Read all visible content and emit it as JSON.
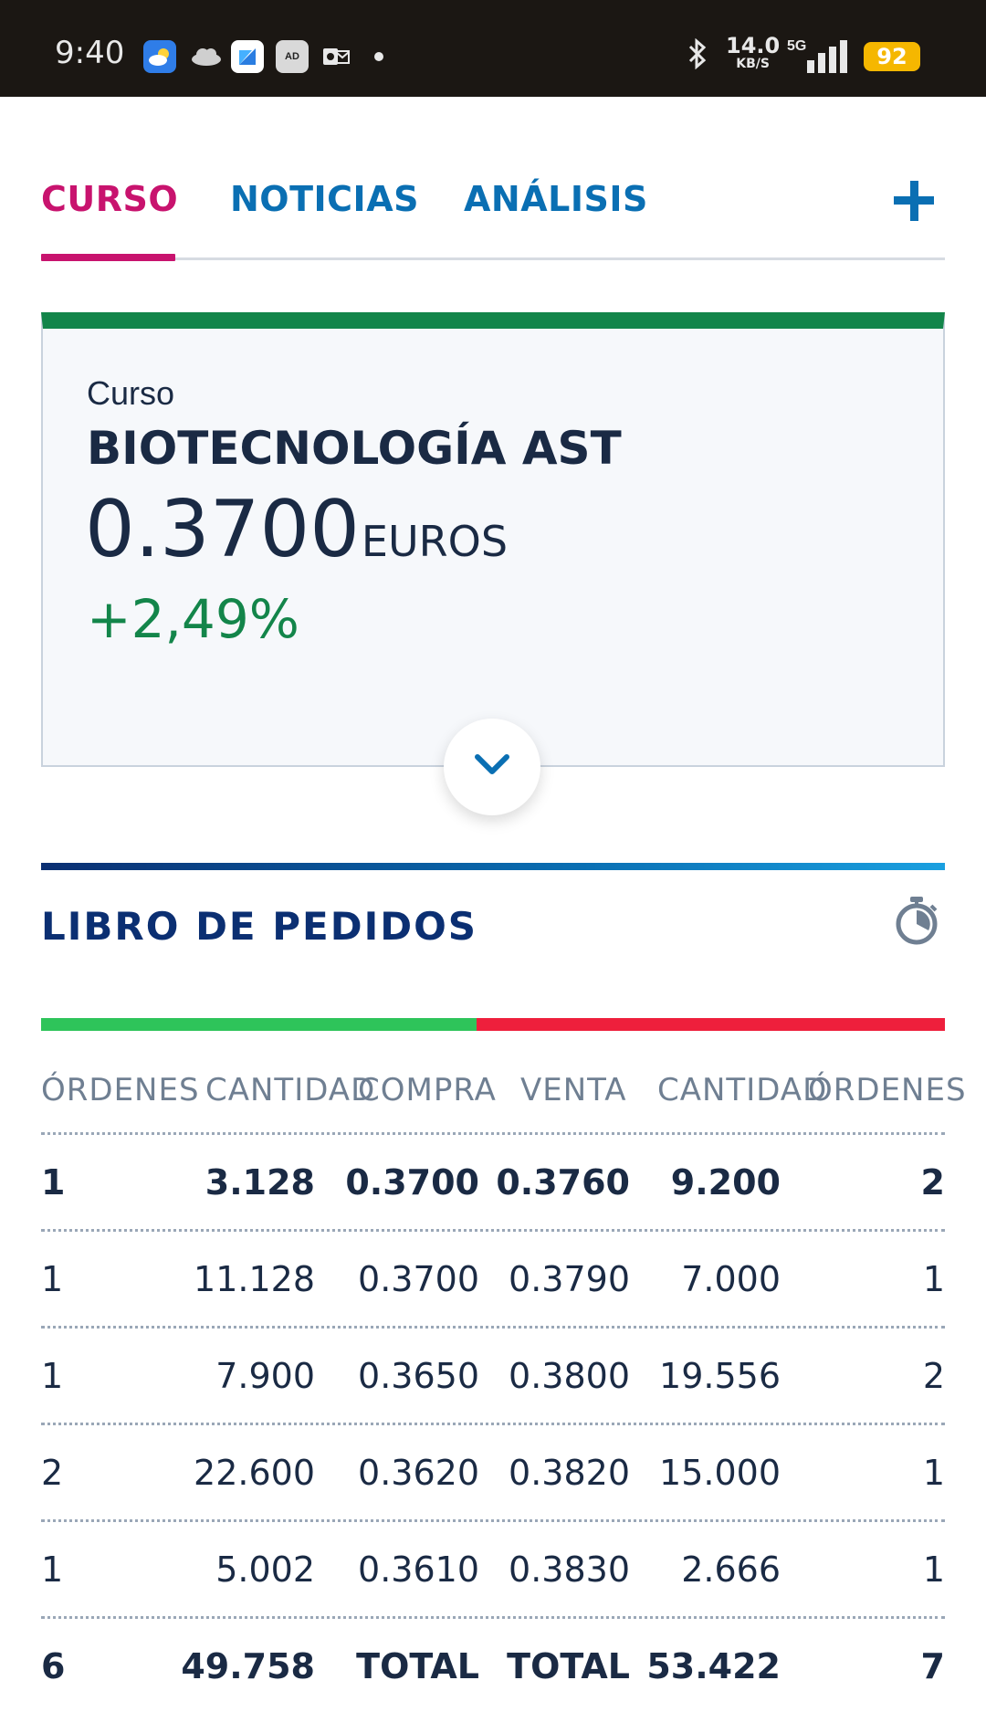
{
  "status_bar": {
    "time": "9:40",
    "speed_value": "14.0",
    "speed_unit": "KB/S",
    "network": "5G",
    "battery": "92",
    "icons": [
      "weather-icon",
      "cloud-icon",
      "app-icon",
      "adblocker-icon",
      "outlook-icon",
      "bluetooth-icon",
      "signal-icon",
      "battery-icon"
    ],
    "adblock_label": "AD"
  },
  "tabs": [
    {
      "label": "CURSO",
      "active": true
    },
    {
      "label": "NOTICIAS",
      "active": false
    },
    {
      "label": "ANÁLISIS",
      "active": false
    }
  ],
  "quote": {
    "label": "Curso",
    "name": "BIOTECNOLOGÍA AST",
    "price": "0.3700",
    "currency": "EUROS",
    "change": "+2,49%"
  },
  "order_book": {
    "title": "LIBRO DE PEDIDOS",
    "buy_share": 0.482,
    "columns": [
      "ÓRDENES",
      "CANTIDAD",
      "COMPRA",
      "VENTA",
      "CANTIDAD",
      "ÓRDENES"
    ],
    "rows": [
      [
        "1",
        "3.128",
        "0.3700",
        "0.3760",
        "9.200",
        "2"
      ],
      [
        "1",
        "11.128",
        "0.3700",
        "0.3790",
        "7.000",
        "1"
      ],
      [
        "1",
        "7.900",
        "0.3650",
        "0.3800",
        "19.556",
        "2"
      ],
      [
        "2",
        "22.600",
        "0.3620",
        "0.3820",
        "15.000",
        "1"
      ],
      [
        "1",
        "5.002",
        "0.3610",
        "0.3830",
        "2.666",
        "1"
      ]
    ],
    "totals": [
      "6",
      "49.758",
      "TOTAL",
      "TOTAL",
      "53.422",
      "7"
    ]
  },
  "colors": {
    "accent_active": "#c8136e",
    "link": "#0a6fb3",
    "positive": "#13854a",
    "buy_bar": "#2ec45a",
    "sell_bar": "#ee1f3c",
    "heading": "#0b2f72"
  }
}
